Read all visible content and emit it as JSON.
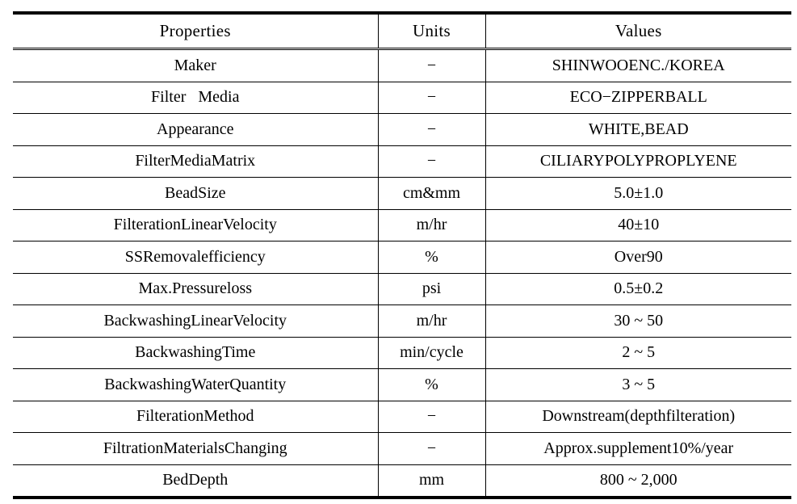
{
  "table": {
    "columns": [
      "Properties",
      "Units",
      "Values"
    ],
    "rows": [
      {
        "property": "Maker",
        "unit": "−",
        "value": "SHINWOOENC./KOREA"
      },
      {
        "property": "Filter   Media",
        "unit": "−",
        "value": "ECO−ZIPPERBALL"
      },
      {
        "property": "Appearance",
        "unit": "−",
        "value": "WHITE,BEAD"
      },
      {
        "property": "FilterMediaMatrix",
        "unit": "−",
        "value": "CILIARYPOLYPROPLYENE"
      },
      {
        "property": "BeadSize",
        "unit": "cm&mm",
        "value": "5.0±1.0"
      },
      {
        "property": "FilterationLinearVelocity",
        "unit": "m/hr",
        "value": "40±10"
      },
      {
        "property": "SSRemovalefficiency",
        "unit": "%",
        "value": "Over90"
      },
      {
        "property": "Max.Pressureloss",
        "unit": "psi",
        "value": "0.5±0.2"
      },
      {
        "property": "BackwashingLinearVelocity",
        "unit": "m/hr",
        "value": "30 ~ 50"
      },
      {
        "property": "BackwashingTime",
        "unit": "min/cycle",
        "value": "2 ~ 5"
      },
      {
        "property": "BackwashingWaterQuantity",
        "unit": "%",
        "value": "3 ~ 5"
      },
      {
        "property": "FilterationMethod",
        "unit": "−",
        "value": "Downstream(depthfilteration)"
      },
      {
        "property": "FiltrationMaterialsChanging",
        "unit": "−",
        "value": "Approx.supplement10%/year"
      },
      {
        "property": "BedDepth",
        "unit": "mm",
        "value": "800 ~ 2,000"
      }
    ]
  },
  "style": {
    "text_color": "#000000",
    "rule_color": "#000000",
    "background": "#ffffff"
  }
}
